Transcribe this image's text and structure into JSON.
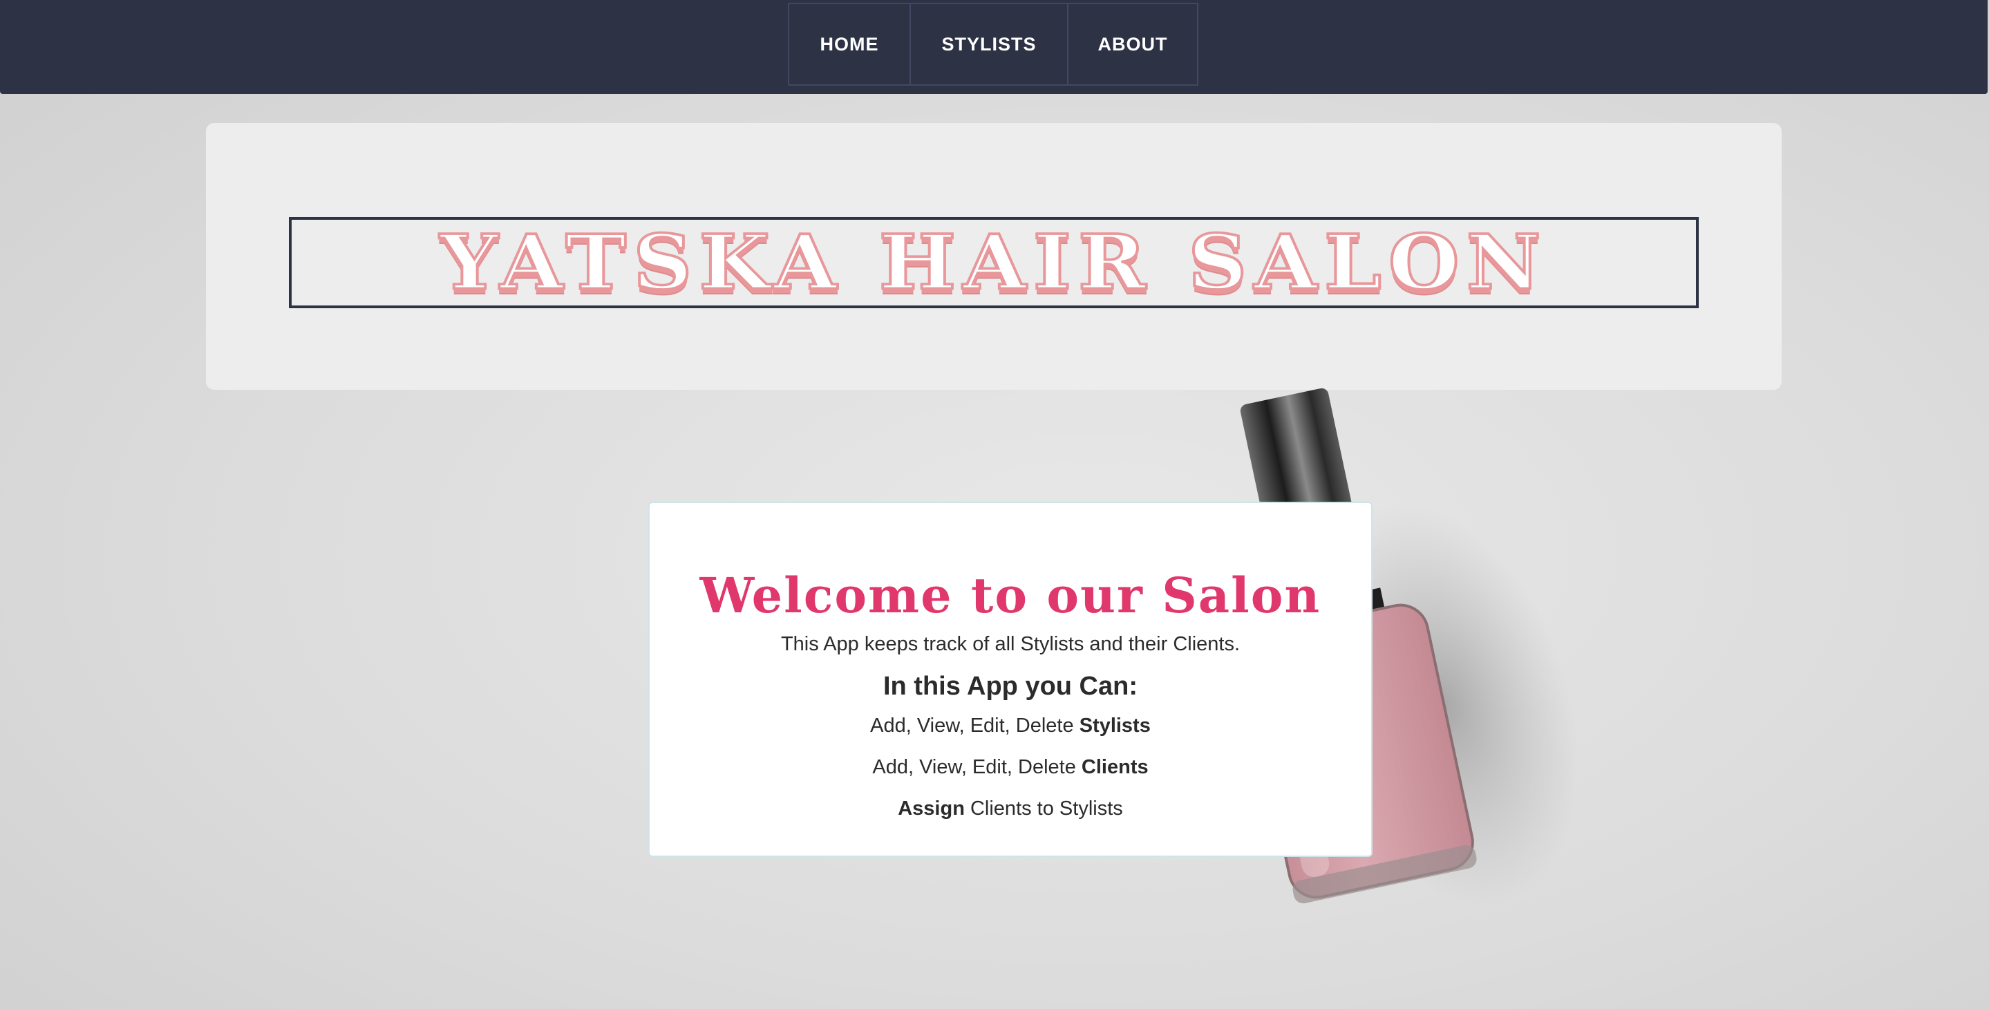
{
  "nav": {
    "items": [
      {
        "label": "HOME"
      },
      {
        "label": "STYLISTS"
      },
      {
        "label": "ABOUT"
      }
    ]
  },
  "header": {
    "title": "YATSKA HAIR SALON"
  },
  "welcome_card": {
    "heading": "Welcome to our Salon",
    "intro": "This App keeps track of all Stylists and their Clients.",
    "subheading": "In this App you Can:",
    "features": [
      {
        "prefix": "Add, View, Edit, Delete ",
        "bold": "Stylists",
        "suffix": ""
      },
      {
        "prefix": "Add, View, Edit, Delete ",
        "bold": "Clients",
        "suffix": ""
      },
      {
        "prefix": "",
        "bold": "Assign",
        "suffix": " Clients to Stylists"
      }
    ]
  },
  "colors": {
    "navbar": "#2d3245",
    "title_pink": "#e8979a",
    "welcome_pink": "#e0386d",
    "polish": "#d9a2aa"
  }
}
